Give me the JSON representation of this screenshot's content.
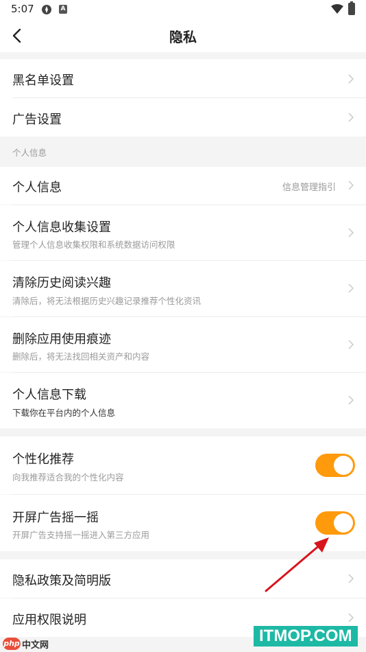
{
  "status_bar": {
    "time": "5:07"
  },
  "nav": {
    "title": "隐私"
  },
  "rows": {
    "blacklist": {
      "label": "黑名单设置"
    },
    "ads": {
      "label": "广告设置"
    },
    "section_personal": "个人信息",
    "personal_info": {
      "label": "个人信息",
      "right": "信息管理指引"
    },
    "collect": {
      "label": "个人信息收集设置",
      "sub": "管理个人信息收集权限和系统数据访问权限"
    },
    "clear_history": {
      "label": "清除历史阅读兴趣",
      "sub": "清除后，将无法根据历史兴趣记录推荐个性化资讯"
    },
    "delete_traces": {
      "label": "删除应用使用痕迹",
      "sub": "删除后，将无法找回相关资产和内容"
    },
    "download": {
      "label": "个人信息下载",
      "sub": "下载你在平台内的个人信息"
    },
    "personalized": {
      "label": "个性化推荐",
      "sub": "向我推荐适合我的个性化内容",
      "enabled": true
    },
    "shake_ad": {
      "label": "开屏广告摇一摇",
      "sub": "开屏广告支持摇一摇进入第三方应用",
      "enabled": true
    },
    "policy": {
      "label": "隐私政策及简明版"
    },
    "permissions": {
      "label": "应用权限说明"
    }
  },
  "watermarks": {
    "left_logo": "php",
    "left_text": "中文网",
    "right_text": "ITMOP.COM"
  },
  "colors": {
    "toggle_on": "#ff9a0d",
    "arrow": "#d8141c"
  }
}
